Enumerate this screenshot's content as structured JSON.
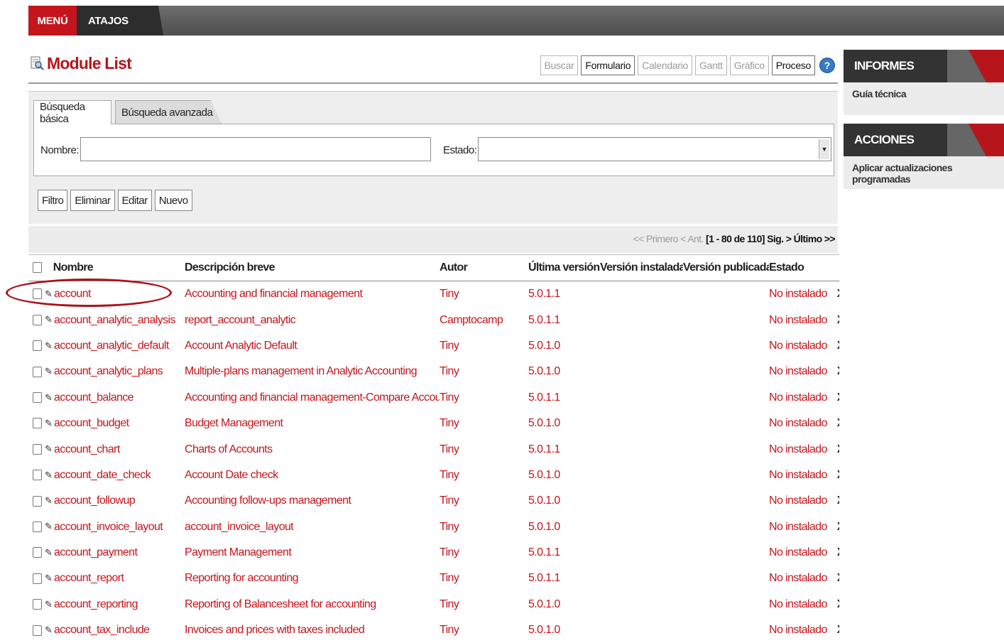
{
  "topbar": {
    "menu_label": "MENÚ",
    "shortcuts_label": "ATAJOS"
  },
  "header": {
    "title": "Module List",
    "view_buttons": [
      {
        "label": "Buscar",
        "active": false
      },
      {
        "label": "Formulario",
        "active": true
      },
      {
        "label": "Calendario",
        "active": false
      },
      {
        "label": "Gantt",
        "active": false
      },
      {
        "label": "Gráfico",
        "active": false
      },
      {
        "label": "Proceso",
        "active": true
      }
    ],
    "help_glyph": "?"
  },
  "search": {
    "tabs": [
      "Búsqueda básica",
      "Búsqueda avanzada"
    ],
    "name_label": "Nombre:",
    "name_value": "",
    "state_label": "Estado:",
    "state_value": ""
  },
  "actions": [
    "Filtro",
    "Eliminar",
    "Editar",
    "Nuevo"
  ],
  "pager": {
    "first": "<< Primero",
    "prev": "< Ant.",
    "range": "[1 - 80 de 110]",
    "next": "Sig. >",
    "last": "Último >>"
  },
  "columns": [
    "Nombre",
    "Descripción breve",
    "Autor",
    "Última versión",
    "Versión instalada",
    "Versión publicada",
    "Estado"
  ],
  "rows": [
    {
      "name": "account",
      "desc": "Accounting and financial management",
      "author": "Tiny",
      "latest": "5.0.1.1",
      "installed": "",
      "published": "",
      "state": "No instalado"
    },
    {
      "name": "account_analytic_analysis",
      "desc": "report_account_analytic",
      "author": "Camptocamp",
      "latest": "5.0.1.1",
      "installed": "",
      "published": "",
      "state": "No instalado"
    },
    {
      "name": "account_analytic_default",
      "desc": "Account Analytic Default",
      "author": "Tiny",
      "latest": "5.0.1.0",
      "installed": "",
      "published": "",
      "state": "No instalado"
    },
    {
      "name": "account_analytic_plans",
      "desc": "Multiple-plans management in Analytic Accounting",
      "author": "Tiny",
      "latest": "5.0.1.0",
      "installed": "",
      "published": "",
      "state": "No instalado"
    },
    {
      "name": "account_balance",
      "desc": "Accounting and financial management-Compare Accounts",
      "author": "Tiny",
      "latest": "5.0.1.1",
      "installed": "",
      "published": "",
      "state": "No instalado"
    },
    {
      "name": "account_budget",
      "desc": "Budget Management",
      "author": "Tiny",
      "latest": "5.0.1.0",
      "installed": "",
      "published": "",
      "state": "No instalado"
    },
    {
      "name": "account_chart",
      "desc": "Charts of Accounts",
      "author": "Tiny",
      "latest": "5.0.1.1",
      "installed": "",
      "published": "",
      "state": "No instalado"
    },
    {
      "name": "account_date_check",
      "desc": "Account Date check",
      "author": "Tiny",
      "latest": "5.0.1.0",
      "installed": "",
      "published": "",
      "state": "No instalado"
    },
    {
      "name": "account_followup",
      "desc": "Accounting follow-ups management",
      "author": "Tiny",
      "latest": "5.0.1.0",
      "installed": "",
      "published": "",
      "state": "No instalado"
    },
    {
      "name": "account_invoice_layout",
      "desc": "account_invoice_layout",
      "author": "Tiny",
      "latest": "5.0.1.0",
      "installed": "",
      "published": "",
      "state": "No instalado"
    },
    {
      "name": "account_payment",
      "desc": "Payment Management",
      "author": "Tiny",
      "latest": "5.0.1.1",
      "installed": "",
      "published": "",
      "state": "No instalado"
    },
    {
      "name": "account_report",
      "desc": "Reporting for accounting",
      "author": "Tiny",
      "latest": "5.0.1.1",
      "installed": "",
      "published": "",
      "state": "No instalado"
    },
    {
      "name": "account_reporting",
      "desc": "Reporting of Balancesheet for accounting",
      "author": "Tiny",
      "latest": "5.0.1.0",
      "installed": "",
      "published": "",
      "state": "No instalado"
    },
    {
      "name": "account_tax_include",
      "desc": "Invoices and prices with taxes included",
      "author": "Tiny",
      "latest": "5.0.1.0",
      "installed": "",
      "published": "",
      "state": "No instalado"
    }
  ],
  "delete_glyph": "X",
  "sidebar": {
    "reports_title": "INFORMES",
    "reports_items": [
      "Guía técnica"
    ],
    "actions_title": "ACCIONES",
    "actions_items": [
      "Aplicar actualizaciones programadas"
    ]
  },
  "colors": {
    "brand_red": "#c4151c",
    "dark": "#333333",
    "panel": "#eeeeee"
  }
}
